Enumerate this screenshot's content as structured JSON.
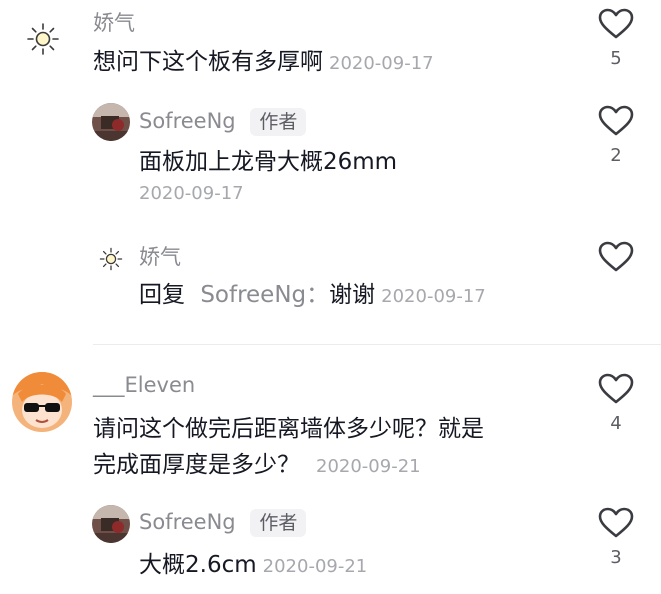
{
  "comments": [
    {
      "author": "娇气",
      "text": "想问下这个板有多厚啊",
      "date": "2020-09-17",
      "likes": "5",
      "replies": [
        {
          "author": "SofreeNg",
          "badge": "作者",
          "text": "面板加上龙骨大概26mm",
          "date": "2020-09-17",
          "likes": "2"
        },
        {
          "author": "娇气",
          "reply_prefix": "回复",
          "reply_to": "SofreeNg：",
          "text": "谢谢",
          "date": "2020-09-17",
          "likes": ""
        }
      ]
    },
    {
      "author": "___Eleven",
      "text_line1": "请问这个做完后距离墙体多少呢？就是",
      "text_line2": "完成面厚度是多少？",
      "date": "2020-09-21",
      "likes": "4",
      "replies": [
        {
          "author": "SofreeNg",
          "badge": "作者",
          "text": "大概2.6cm",
          "date": "2020-09-21",
          "likes": "3"
        }
      ]
    }
  ],
  "colors": {
    "text": "#161823",
    "meta": "#8a8b91",
    "date": "#a7a8ad",
    "divider": "#ececee"
  },
  "icons": {
    "like": "heart-outline-icon",
    "avatar1": "sun-avatar",
    "avatar2": "anime-sunglasses-avatar",
    "avatar3": "photo-avatar"
  }
}
